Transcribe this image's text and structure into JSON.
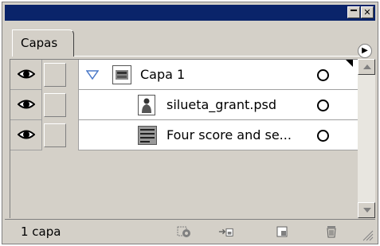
{
  "panel": {
    "tab_label": "Capas"
  },
  "layers": [
    {
      "name": "Capa 1",
      "visible": true,
      "locked": false,
      "expanded": true,
      "level": 0,
      "thumb": "layer-thumb"
    },
    {
      "name": "silueta_grant.psd",
      "visible": true,
      "locked": false,
      "level": 1,
      "thumb": "silhouette-thumb"
    },
    {
      "name": "Four score and se...",
      "visible": true,
      "locked": false,
      "level": 1,
      "thumb": "text-thumb"
    }
  ],
  "status": {
    "count_label": "1 capa"
  },
  "icons": {
    "visibility": "eye-icon",
    "close": "close-icon",
    "minimize": "minimize-icon",
    "menu": "panel-menu-icon",
    "clipping_mask": "clipping-mask-icon",
    "new_sublayer": "new-sublayer-icon",
    "new_layer": "new-layer-icon",
    "delete": "trash-icon"
  },
  "colors": {
    "titlebar": "#0a246a",
    "panel": "#d4d0c8"
  }
}
